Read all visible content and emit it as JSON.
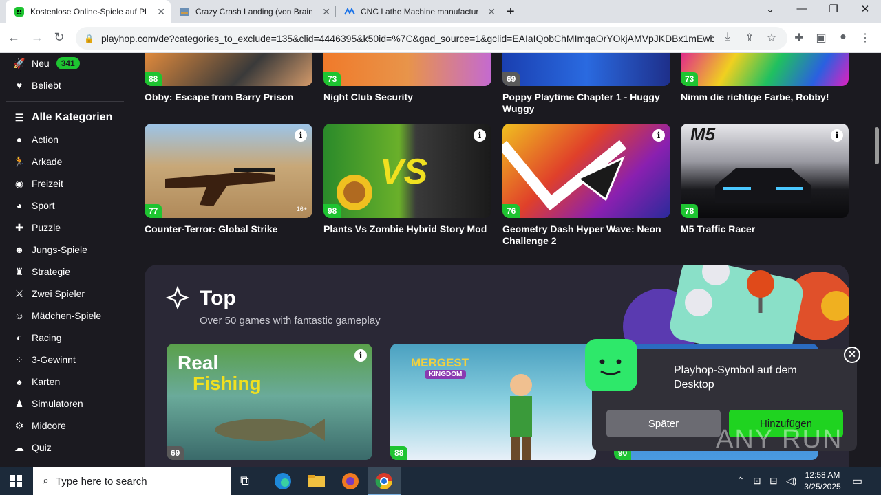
{
  "tabs": [
    {
      "title": "Kostenlose Online-Spiele auf Pla",
      "active": true
    },
    {
      "title": "Crazy Crash Landing (von Brainl",
      "active": false
    },
    {
      "title": "CNC Lathe Machine manufactur",
      "active": false
    }
  ],
  "new_tab": "+",
  "url": "playhop.com/de?categories_to_exclude=135&clid=4446395&k50id=%7C&gad_source=1&gclid=EAIaIQobChMImqaOrYOkjAMVpJKDBx1mEwb...",
  "sidebar": {
    "neu": {
      "label": "Neu",
      "badge": "341"
    },
    "beliebt": "Beliebt",
    "all_categories": "Alle Kategorien",
    "categories": [
      "Action",
      "Arkade",
      "Freizeit",
      "Sport",
      "Puzzle",
      "Jungs-Spiele",
      "Strategie",
      "Zwei Spieler",
      "Mädchen-Spiele",
      "Racing",
      "3-Gewinnt",
      "Karten",
      "Simulatoren",
      "Midcore",
      "Quiz"
    ]
  },
  "games_row1": [
    {
      "title": "Obby: Escape from Barry Prison",
      "rating": "88"
    },
    {
      "title": "Night Club Security",
      "rating": "73"
    },
    {
      "title": "Poppy Playtime Chapter 1 - Huggy Wuggy",
      "rating": "69"
    },
    {
      "title": "Nimm die richtige Farbe, Robby!",
      "rating": "73"
    }
  ],
  "games_row2": [
    {
      "title": "Counter-Terror: Global Strike",
      "rating": "77",
      "age": "16+"
    },
    {
      "title": "Plants Vs Zombie Hybrid Story Mod",
      "rating": "98",
      "thumb_text": "VS"
    },
    {
      "title": "Geometry Dash Hyper Wave: Neon Challenge 2",
      "rating": "76"
    },
    {
      "title": "M5 Traffic Racer",
      "rating": "78",
      "thumb_text": "M5"
    }
  ],
  "top": {
    "heading": "Top",
    "subtitle": "Over 50 games with fantastic gameplay",
    "cards": [
      {
        "rating": "69",
        "thumb_line1": "Real",
        "thumb_line2": "Fishing"
      },
      {
        "rating": "88",
        "thumb_line1": "MERGEST",
        "thumb_line2": "KINGDOM"
      },
      {
        "rating": "90"
      }
    ]
  },
  "popup": {
    "text": "Playhop-Symbol auf dem Desktop",
    "later": "Später",
    "add": "Hinzufügen",
    "close": "✕"
  },
  "watermark": "ANY RUN",
  "taskbar": {
    "search_placeholder": "Type here to search",
    "time": "12:58 AM",
    "date": "3/25/2025"
  },
  "colors": {
    "accent_green": "#1ec431",
    "page_bg": "#1b1a20",
    "section_bg": "#2a2836"
  }
}
